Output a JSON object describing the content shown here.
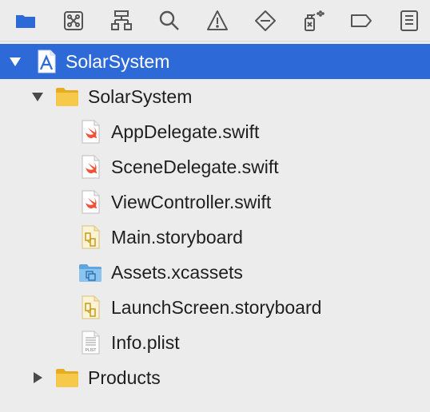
{
  "toolbar": {
    "icons": [
      {
        "name": "project-navigator-folder-icon",
        "active": true
      },
      {
        "name": "source-control-icon",
        "active": false
      },
      {
        "name": "symbol-hierarchy-icon",
        "active": false
      },
      {
        "name": "find-magnifier-icon",
        "active": false
      },
      {
        "name": "issue-warning-icon",
        "active": false
      },
      {
        "name": "test-diamond-icon",
        "active": false
      },
      {
        "name": "debug-spray-icon",
        "active": false
      },
      {
        "name": "breakpoint-tag-icon",
        "active": false
      },
      {
        "name": "report-list-icon",
        "active": false
      }
    ]
  },
  "colors": {
    "selection": "#2e6ad7",
    "folder": "#f3c342",
    "active_toolbar_icon": "#2e6ad7",
    "swift_accent": "#f05138"
  },
  "tree": {
    "project": {
      "label": "SolarSystem",
      "expanded": true,
      "icon": "xcode-project-icon"
    },
    "group": {
      "label": "SolarSystem",
      "expanded": true,
      "icon": "folder-icon"
    },
    "files": [
      {
        "label": "AppDelegate.swift",
        "icon": "swift-file-icon"
      },
      {
        "label": "SceneDelegate.swift",
        "icon": "swift-file-icon"
      },
      {
        "label": "ViewController.swift",
        "icon": "swift-file-icon"
      },
      {
        "label": "Main.storyboard",
        "icon": "storyboard-file-icon"
      },
      {
        "label": "Assets.xcassets",
        "icon": "asset-catalog-icon"
      },
      {
        "label": "LaunchScreen.storyboard",
        "icon": "storyboard-file-icon"
      },
      {
        "label": "Info.plist",
        "icon": "plist-file-icon",
        "badge": "PLIST"
      }
    ],
    "products": {
      "label": "Products",
      "expanded": false,
      "icon": "folder-icon"
    }
  }
}
